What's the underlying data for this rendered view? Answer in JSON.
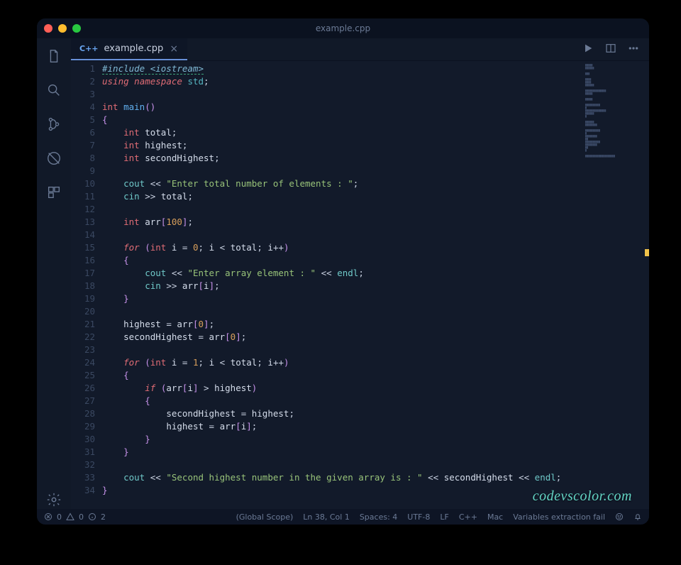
{
  "window": {
    "title": "example.cpp"
  },
  "tab": {
    "lang_icon": "C++",
    "filename": "example.cpp",
    "close_glyph": "×"
  },
  "gutter": {
    "start": 1,
    "end": 34
  },
  "code": {
    "plain": "#include <iostream>\nusing namespace std;\n\nint main()\n{\n    int total;\n    int highest;\n    int secondHighest;\n\n    cout << \"Enter total number of elements : \";\n    cin >> total;\n\n    int arr[100];\n\n    for (int i = 0; i < total; i++)\n    {\n        cout << \"Enter array element : \" << endl;\n        cin >> arr[i];\n    }\n\n    highest = arr[0];\n    secondHighest = arr[0];\n\n    for (int i = 1; i < total; i++)\n    {\n        if (arr[i] > highest)\n        {\n            secondHighest = highest;\n            highest = arr[i];\n        }\n    }\n\n    cout << \"Second highest number in the given array is : \" << secondHighest << endl;\n}"
  },
  "statusbar": {
    "errors": "0",
    "warnings": "0",
    "info": "2",
    "scope": "(Global Scope)",
    "cursor": "Ln 38, Col 1",
    "spaces": "Spaces: 4",
    "encoding": "UTF-8",
    "eol": "LF",
    "language": "C++",
    "os": "Mac",
    "extra": "Variables extraction fail"
  },
  "watermark": "codevscolor.com"
}
